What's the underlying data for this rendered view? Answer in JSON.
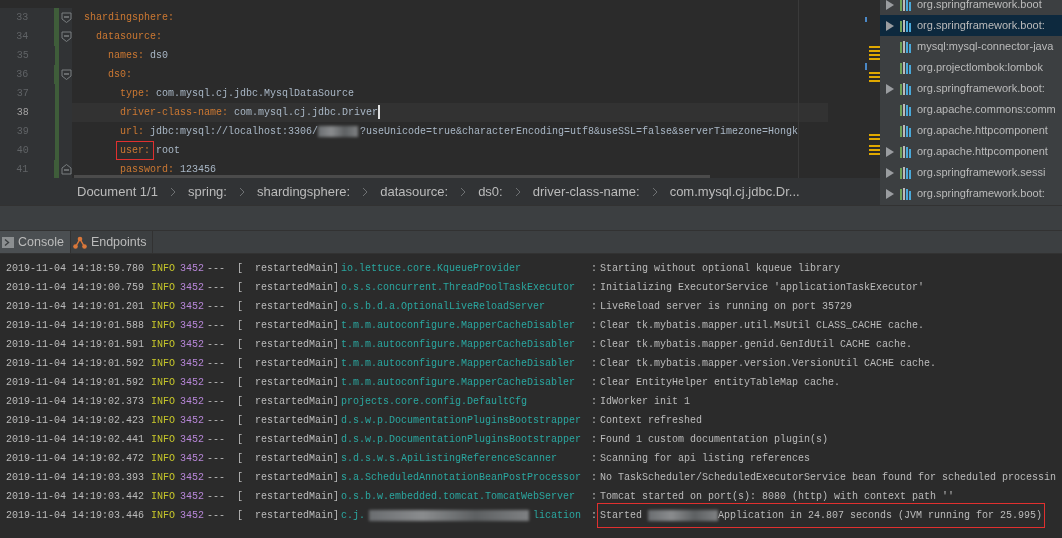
{
  "editor": {
    "lines": [
      {
        "number": "33",
        "kind": "entry",
        "key": "shardingsphere:",
        "changed": true,
        "current": false,
        "children": [
          {
            "number": "34",
            "kind": "entry",
            "key": "datasource:",
            "changed": true,
            "current": false,
            "children": [
              {
                "number": "35",
                "kind": "entry",
                "key": "names:",
                "value": [
                  "ds0"
                ],
                "changed": true,
                "current": false
              },
              {
                "number": "36",
                "kind": "entry",
                "key": "ds0:",
                "changed": true,
                "current": false,
                "children": [
                  {
                    "number": "37",
                    "kind": "entry",
                    "key": "type:",
                    "value": [
                      "com.mysql.cj.jdbc.MysqlDataSource"
                    ],
                    "changed": true,
                    "current": false
                  },
                  {
                    "number": "38",
                    "kind": "entry",
                    "key": "driver-class-name:",
                    "value": [
                      "com.mysql.cj.jdbc.Driver"
                    ],
                    "changed": true,
                    "current": true
                  },
                  {
                    "number": "39",
                    "kind": "entry",
                    "key": "url:",
                    "value": [
                      "jdbc:mysql://localhost:3306/",
                      "?useUnicode=true&characterEncoding=utf8&useSSL=false&serverTimezone=Hongk"
                    ],
                    "changed": true,
                    "current": false
                  },
                  {
                    "number": "40",
                    "kind": "entry",
                    "key": "user:",
                    "value": [
                      "root"
                    ],
                    "boxed": true,
                    "changed": true,
                    "current": false
                  },
                  {
                    "number": "41",
                    "kind": "entry",
                    "key": "password:",
                    "value": [
                      "123456"
                    ],
                    "fold_end": true,
                    "changed": true,
                    "current": false
                  }
                ]
              }
            ]
          }
        ]
      }
    ]
  },
  "breadcrumb": [
    "Document 1/1",
    "spring:",
    "shardingsphere:",
    "datasource:",
    "ds0:",
    "driver-class-name:",
    "com.mysql.cj.jdbc.Dr..."
  ],
  "dependencies": [
    {
      "label": "org.springframework.boot",
      "expandable": true,
      "selected": false
    },
    {
      "label": "org.springframework.boot:",
      "expandable": true,
      "selected": true
    },
    {
      "label": "mysql:mysql-connector-java",
      "expandable": false,
      "selected": false
    },
    {
      "label": "org.projectlombok:lombok",
      "expandable": false,
      "selected": false
    },
    {
      "label": "org.springframework.boot:",
      "expandable": true,
      "selected": false
    },
    {
      "label": "org.apache.commons:comm",
      "expandable": false,
      "selected": false
    },
    {
      "label": "org.apache.httpcomponent",
      "expandable": false,
      "selected": false
    },
    {
      "label": "org.apache.httpcomponent",
      "expandable": true,
      "selected": false
    },
    {
      "label": "org.springframework.sessi",
      "expandable": true,
      "selected": false
    },
    {
      "label": "org.springframework.boot:",
      "expandable": true,
      "selected": false
    }
  ],
  "tool_tabs": [
    {
      "label": "Console",
      "kind": "console",
      "selected": true
    },
    {
      "label": "Endpoints",
      "kind": "endpoints",
      "selected": false
    }
  ],
  "log": [
    {
      "time": "2019-11-04 14:18:59.780",
      "level": "INFO",
      "pid": "3452",
      "sep": "---",
      "thread": "[  restartedMain]",
      "logger": [
        "io.lettuce.core.KqueueProvider"
      ],
      "colon": ":",
      "message": [
        "Starting without optional kqueue library"
      ]
    },
    {
      "time": "2019-11-04 14:19:00.759",
      "level": "INFO",
      "pid": "3452",
      "sep": "---",
      "thread": "[  restartedMain]",
      "logger": [
        "o.s.s.concurrent.ThreadPoolTaskExecutor"
      ],
      "colon": ":",
      "message": [
        "Initializing ExecutorService 'applicationTaskExecutor'"
      ]
    },
    {
      "time": "2019-11-04 14:19:01.201",
      "level": "INFO",
      "pid": "3452",
      "sep": "---",
      "thread": "[  restartedMain]",
      "logger": [
        "o.s.b.d.a.OptionalLiveReloadServer"
      ],
      "colon": ":",
      "message": [
        "LiveReload server is running on port 35729"
      ]
    },
    {
      "time": "2019-11-04 14:19:01.588",
      "level": "INFO",
      "pid": "3452",
      "sep": "---",
      "thread": "[  restartedMain]",
      "logger": [
        "t.m.m.autoconfigure.MapperCacheDisabler"
      ],
      "colon": ":",
      "message": [
        "Clear tk.mybatis.mapper.util.MsUtil CLASS_CACHE cache."
      ]
    },
    {
      "time": "2019-11-04 14:19:01.591",
      "level": "INFO",
      "pid": "3452",
      "sep": "---",
      "thread": "[  restartedMain]",
      "logger": [
        "t.m.m.autoconfigure.MapperCacheDisabler"
      ],
      "colon": ":",
      "message": [
        "Clear tk.mybatis.mapper.genid.GenIdUtil CACHE cache."
      ]
    },
    {
      "time": "2019-11-04 14:19:01.592",
      "level": "INFO",
      "pid": "3452",
      "sep": "---",
      "thread": "[  restartedMain]",
      "logger": [
        "t.m.m.autoconfigure.MapperCacheDisabler"
      ],
      "colon": ":",
      "message": [
        "Clear tk.mybatis.mapper.version.VersionUtil CACHE cache."
      ]
    },
    {
      "time": "2019-11-04 14:19:01.592",
      "level": "INFO",
      "pid": "3452",
      "sep": "---",
      "thread": "[  restartedMain]",
      "logger": [
        "t.m.m.autoconfigure.MapperCacheDisabler"
      ],
      "colon": ":",
      "message": [
        "Clear EntityHelper entityTableMap cache."
      ]
    },
    {
      "time": "2019-11-04 14:19:02.373",
      "level": "INFO",
      "pid": "3452",
      "sep": "---",
      "thread": "[  restartedMain]",
      "logger": [
        "projects.core.config.DefaultCfg"
      ],
      "colon": ":",
      "message": [
        "IdWorker init 1"
      ]
    },
    {
      "time": "2019-11-04 14:19:02.423",
      "level": "INFO",
      "pid": "3452",
      "sep": "---",
      "thread": "[  restartedMain]",
      "logger": [
        "d.s.w.p.DocumentationPluginsBootstrapper"
      ],
      "colon": ":",
      "message": [
        "Context refreshed"
      ]
    },
    {
      "time": "2019-11-04 14:19:02.441",
      "level": "INFO",
      "pid": "3452",
      "sep": "---",
      "thread": "[  restartedMain]",
      "logger": [
        "d.s.w.p.DocumentationPluginsBootstrapper"
      ],
      "colon": ":",
      "message": [
        "Found 1 custom documentation plugin(s)"
      ]
    },
    {
      "time": "2019-11-04 14:19:02.472",
      "level": "INFO",
      "pid": "3452",
      "sep": "---",
      "thread": "[  restartedMain]",
      "logger": [
        "s.d.s.w.s.ApiListingReferenceScanner"
      ],
      "colon": ":",
      "message": [
        "Scanning for api listing references"
      ]
    },
    {
      "time": "2019-11-04 14:19:03.393",
      "level": "INFO",
      "pid": "3452",
      "sep": "---",
      "thread": "[  restartedMain]",
      "logger": [
        "s.a.ScheduledAnnotationBeanPostProcessor"
      ],
      "colon": ":",
      "message": [
        "No TaskScheduler/ScheduledExecutorService bean found for scheduled processin"
      ]
    },
    {
      "time": "2019-11-04 14:19:03.442",
      "level": "INFO",
      "pid": "3452",
      "sep": "---",
      "thread": "[  restartedMain]",
      "logger": [
        "o.s.b.w.embedded.tomcat.TomcatWebServer"
      ],
      "colon": ":",
      "message": [
        "Tomcat started on port(s): 8080 (http) with context path ''"
      ]
    },
    {
      "time": "2019-11-04 14:19:03.446",
      "level": "INFO",
      "pid": "3452",
      "sep": "---",
      "thread": "[  restartedMain]",
      "logger": [
        "c.j.",
        "lication"
      ],
      "colon": ":",
      "message": [
        "Started ",
        "Application in 24.807 seconds (JVM running for 25.995)"
      ],
      "boxed": true
    }
  ]
}
